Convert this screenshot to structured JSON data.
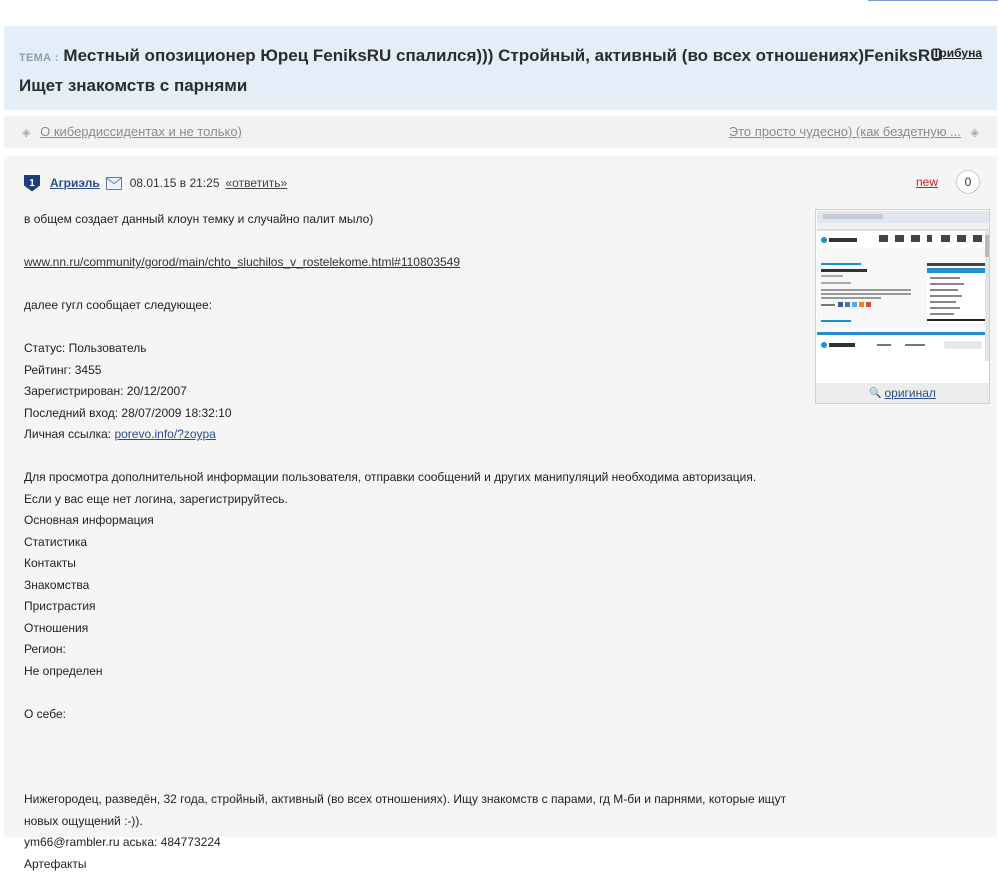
{
  "theme": {
    "label": "ТЕМА :",
    "title": "Местный опозиционер Юрец FeniksRU спалился))) Стройный, активный (во всех отношениях)FeniksRU Ищет знакомств с парнями",
    "forum_link": "Трибуна"
  },
  "nav": {
    "prev": "О кибердиссидентах и не только)",
    "next": "Это просто чудесно) (как бездетную ..."
  },
  "post": {
    "rank": "1",
    "author": "Агриэль",
    "date": "08.01.15 в 21:25",
    "reply": "«ответить»",
    "new_label": "new",
    "counter": "0",
    "image_link": "оригинал",
    "lines": {
      "l1": "в общем создает данный клоун темку и случайно палит мыло)",
      "link": "www.nn.ru/community/gorod/main/chto_sluchilos_v_rostelekome.html#110803549",
      "l3": "далее гугл сообщает следующее:",
      "status": "Статус: Пользователь",
      "rating": "Рейтинг: 3455",
      "registered": "Зарегистрирован: 20/12/2007",
      "last_login": "Последний вход: 28/07/2009 18:32:10",
      "personal_label": "Личная ссылка: ",
      "personal_link": "porevo.info/?zoypa",
      "auth1": "Для просмотра дополнительной информации пользователя, отправки сообщений и других манипуляций необходима авторизация.",
      "auth2": "Если у вас еще нет логина, зарегистрируйтесь.",
      "basic": "Основная информация",
      "stats": "Статистика",
      "contacts": "Контакты",
      "dating": "Знакомства",
      "prefs": "Пристрастия",
      "relations": "Отношения",
      "region": "Регион:",
      "undefined": "Не определен",
      "about": "О себе:",
      "bio": "Нижегородец, разведён, 32 года, стройный, активный (во всех отношениях). Ищу знакомств с парами, гд М-би и парнями, которые ищут новых ощущений :-)).",
      "contact": "ym66@rambler.ru аська: 484773224",
      "artifacts": "Артефакты"
    }
  },
  "colors": {
    "theme_bg": "#e4eef9",
    "author": "#2a4f88",
    "new": "#cc1d1d"
  }
}
